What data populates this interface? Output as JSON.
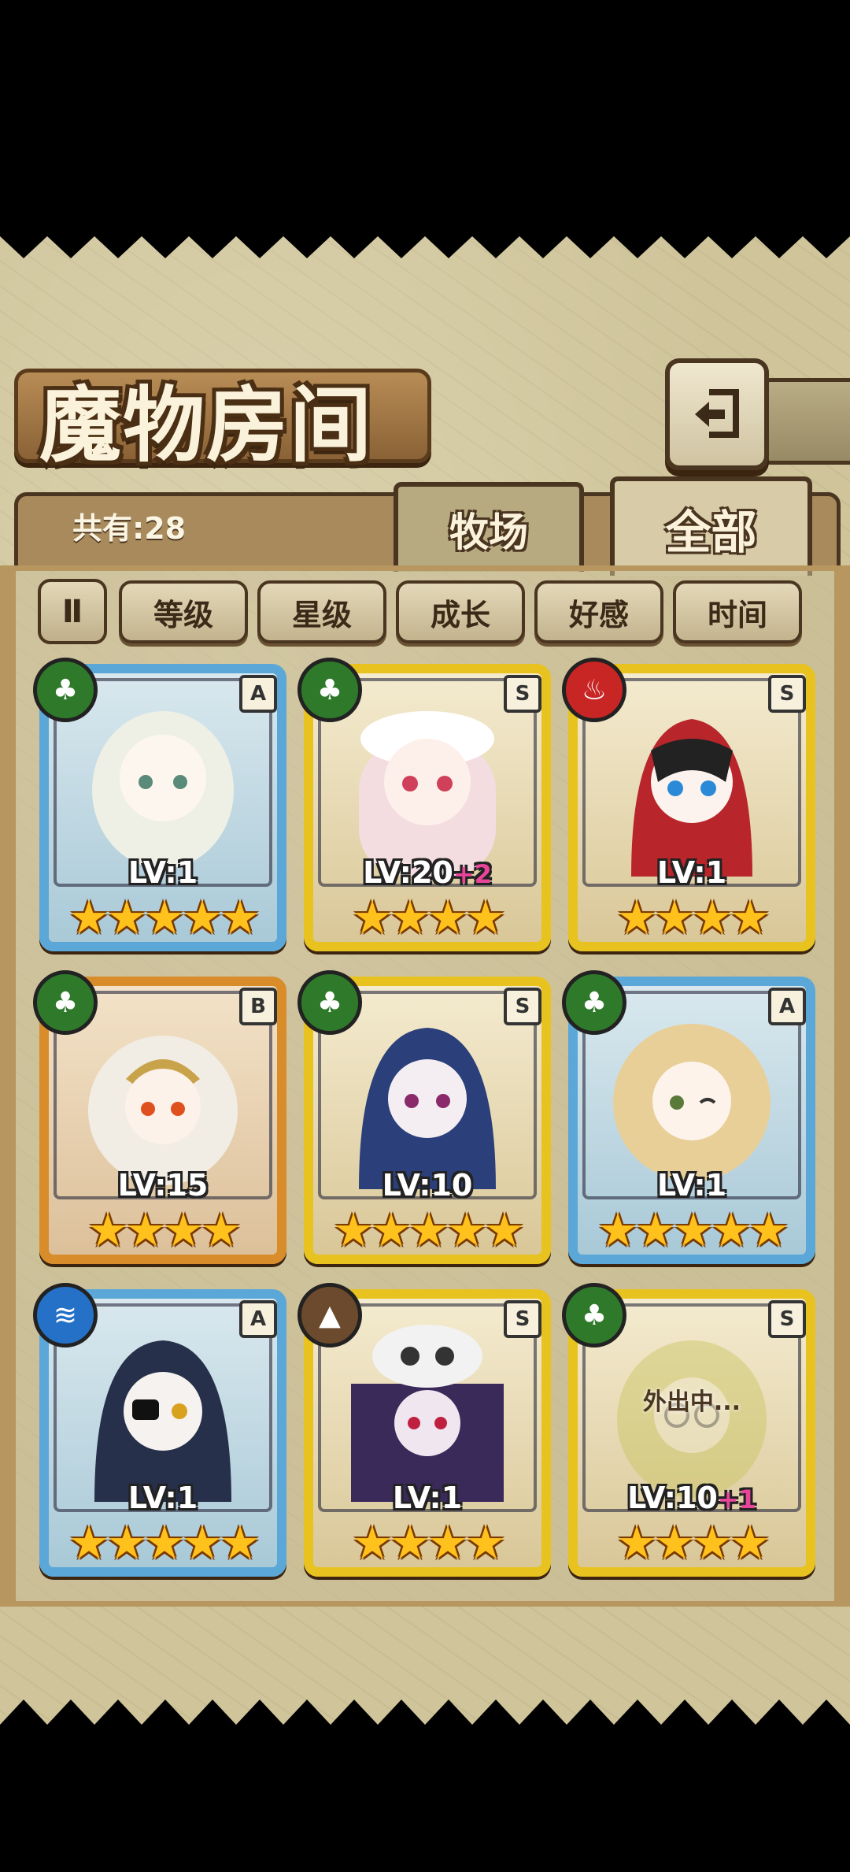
{
  "title": "魔物房间",
  "count_label": "共有:28",
  "back_icon": "return-arrow-icon",
  "tabs": [
    {
      "label": "牧场",
      "active": false
    },
    {
      "label": "全部",
      "active": true
    }
  ],
  "sort_buttons": [
    "等级",
    "星级",
    "成长",
    "好感",
    "时间"
  ],
  "pause_glyph": "Ⅱ",
  "colors": {
    "frame_blue": "#5aa7d8",
    "frame_gold": "#e8c21f",
    "frame_orange": "#d98c2a",
    "star": "#ffc21c",
    "bonus": "#e8459a"
  },
  "monsters": [
    {
      "element": "leaf-icon",
      "rank": "A",
      "level": "LV:1",
      "bonus": "",
      "stars": "★★★★★",
      "frame": "blue",
      "status": ""
    },
    {
      "element": "leaf-icon",
      "rank": "S",
      "level": "LV:20",
      "bonus": "+2",
      "stars": "★★★★",
      "frame": "gold",
      "status": ""
    },
    {
      "element": "fire-icon",
      "rank": "S",
      "level": "LV:1",
      "bonus": "",
      "stars": "★★★★",
      "frame": "gold",
      "status": ""
    },
    {
      "element": "leaf-icon",
      "rank": "B",
      "level": "LV:15",
      "bonus": "",
      "stars": "★★★★",
      "frame": "orange",
      "status": ""
    },
    {
      "element": "leaf-icon",
      "rank": "S",
      "level": "LV:10",
      "bonus": "",
      "stars": "★★★★★",
      "frame": "gold",
      "status": ""
    },
    {
      "element": "leaf-icon",
      "rank": "A",
      "level": "LV:1",
      "bonus": "",
      "stars": "★★★★★",
      "frame": "blue",
      "status": ""
    },
    {
      "element": "water-icon",
      "rank": "A",
      "level": "LV:1",
      "bonus": "",
      "stars": "★★★★★",
      "frame": "blue",
      "status": ""
    },
    {
      "element": "earth-icon",
      "rank": "S",
      "level": "LV:1",
      "bonus": "",
      "stars": "★★★★",
      "frame": "gold",
      "status": ""
    },
    {
      "element": "leaf-icon",
      "rank": "S",
      "level": "LV:10",
      "bonus": "+1",
      "stars": "★★★★",
      "frame": "gold",
      "status": "外出中..."
    }
  ]
}
